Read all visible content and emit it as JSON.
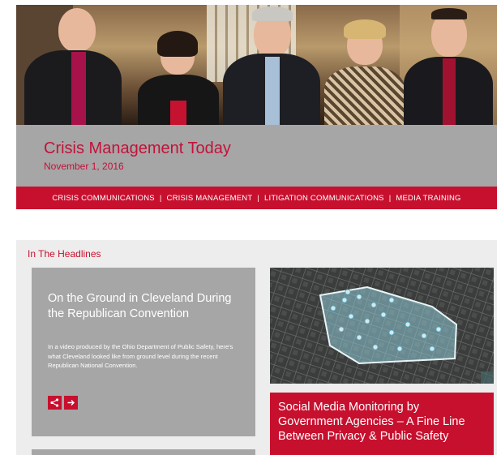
{
  "newsletter": {
    "title": "Crisis Management Today",
    "date": "November 1, 2016"
  },
  "nav": {
    "items": [
      "CRISIS COMMUNICATIONS",
      "CRISIS MANAGEMENT",
      "LITIGATION COMMUNICATIONS",
      "MEDIA TRAINING"
    ],
    "separator": "|"
  },
  "headlines": {
    "section_label": "In The Headlines",
    "cards": [
      {
        "title": "On the Ground in Cleveland During the Republican Convention",
        "description": "In a video produced by the Ohio Department of Public Safety, here's what Cleveland looked like from ground level during the recent Republican National Convention.",
        "share_icon": "share-icon",
        "arrow_icon": "arrow-right-icon"
      },
      {
        "title": "Social Media Monitoring by Government Agencies – A Fine Line Between Privacy & Public Safety",
        "image_icon": "map-image"
      }
    ]
  },
  "colors": {
    "brand_red": "#c7102e",
    "gray_panel": "#a7a6a6",
    "section_bg": "#ededed"
  }
}
